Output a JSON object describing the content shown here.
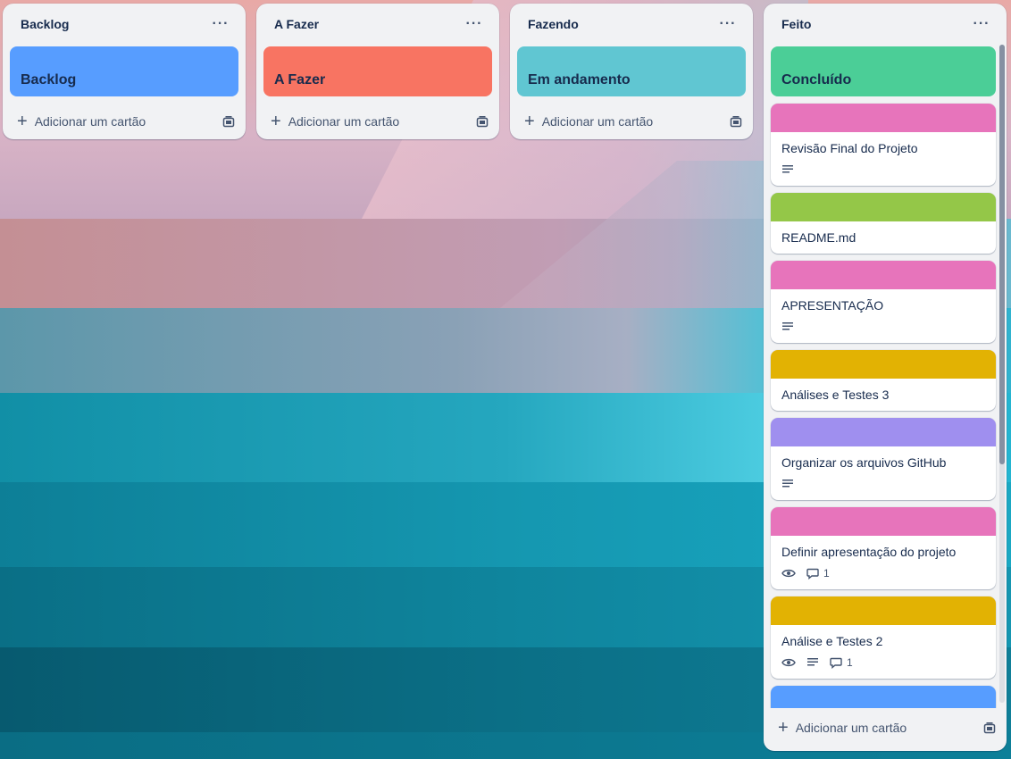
{
  "colors": {
    "backlog": "#579dff",
    "afazer": "#f87462",
    "fazendo": "#60c6d2",
    "concluido": "#4bce97",
    "pink": "#e774bb",
    "green": "#94c748",
    "yellow": "#e2b203",
    "purple": "#9f8fef",
    "blue": "#579dff"
  },
  "lists": [
    {
      "title": "Backlog",
      "more": "···",
      "cover": "Backlog",
      "add_label": "Adicionar um cartão"
    },
    {
      "title": "A Fazer",
      "more": "···",
      "cover": "A Fazer",
      "add_label": "Adicionar um cartão"
    },
    {
      "title": "Fazendo",
      "more": "···",
      "cover": "Em andamento",
      "add_label": "Adicionar um cartão"
    },
    {
      "title": "Feito",
      "more": "···",
      "cover": "Concluído",
      "add_label": "Adicionar um cartão",
      "cards": [
        {
          "title": "Revisão Final do Projeto"
        },
        {
          "title": "README.md"
        },
        {
          "title": "APRESENTAÇÃO"
        },
        {
          "title": "Análises e Testes 3"
        },
        {
          "title": "Organizar os arquivos GitHub"
        },
        {
          "title": "Definir apresentação do projeto",
          "comments": "1"
        },
        {
          "title": "Análise e Testes 2",
          "comments": "1"
        }
      ]
    }
  ],
  "icons": {
    "more": "ellipsis-icon",
    "add": "plus-icon",
    "template": "card-template-icon",
    "description": "description-icon",
    "watch": "eye-icon",
    "comment": "comment-icon"
  }
}
